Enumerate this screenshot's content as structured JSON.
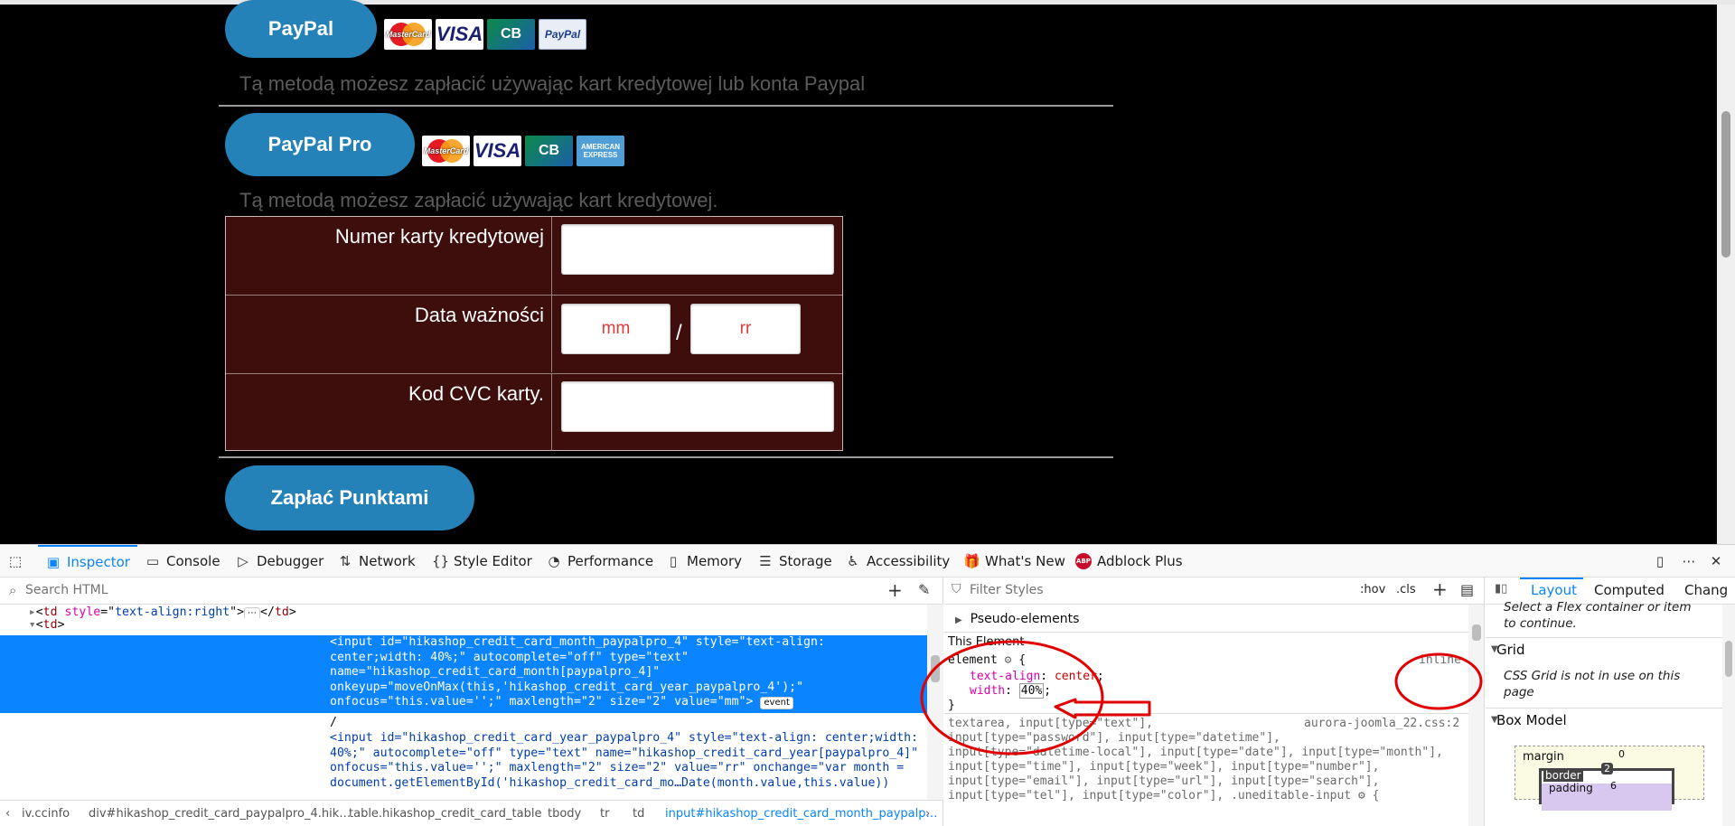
{
  "webpage": {
    "paypal_button": "PayPal",
    "paypal_desc": "Tą metodą możesz zapłacić używając kart kredytowej lub konta Paypal",
    "paypal_pro_button": "PayPal Pro",
    "paypal_pro_desc": "Tą metodą możesz zapłacić używając kart kredytowej.",
    "card_logos": {
      "mastercard": "MasterCard",
      "visa": "VISA",
      "cb": "CB",
      "paypal": "PayPal",
      "amex": "AMERICAN EXPRESS"
    },
    "form": {
      "card_number_label": "Numer karty kredytowej",
      "expiry_label": "Data ważności",
      "month_value": "mm",
      "year_value": "rr",
      "slash": "/",
      "cvc_label": "Kod CVC karty."
    },
    "points_button": "Zapłać Punktami"
  },
  "devtools": {
    "tabs": [
      {
        "label": "Inspector",
        "icon": "inspector-icon",
        "active": true
      },
      {
        "label": "Console",
        "icon": "console-icon"
      },
      {
        "label": "Debugger",
        "icon": "debugger-icon"
      },
      {
        "label": "Network",
        "icon": "network-icon"
      },
      {
        "label": "Style Editor",
        "icon": "style-editor-icon"
      },
      {
        "label": "Performance",
        "icon": "performance-icon"
      },
      {
        "label": "Memory",
        "icon": "memory-icon"
      },
      {
        "label": "Storage",
        "icon": "storage-icon"
      },
      {
        "label": "Accessibility",
        "icon": "accessibility-icon"
      },
      {
        "label": "What's New",
        "icon": "whats-new-icon"
      },
      {
        "label": "Adblock Plus",
        "icon": "adblock-plus-icon"
      }
    ],
    "abp_badge": "ABP",
    "markup": {
      "search_placeholder": "Search HTML",
      "line0_td": "td",
      "line0_style_attr": "style",
      "line0_style_val": "text-align:right",
      "line1_td": "td",
      "sel_line1": "<input id=\"hikashop_credit_card_month_paypalpro_4\" style=\"text-align:",
      "sel_line2": "center;width: 40%;\" autocomplete=\"off\" type=\"text\"",
      "sel_line3": "name=\"hikashop_credit_card_month[paypalpro_4]\"",
      "sel_line4": "onkeyup=\"moveOnMax(this,'hikashop_credit_card_year_paypalpro_4');\"",
      "sel_line5": "onfocus=\"this.value='';\" maxlength=\"2\" size=\"2\" value=\"mm\">",
      "event_badge": "event",
      "slash_line": "/",
      "y_line1": "<input id=\"hikashop_credit_card_year_paypalpro_4\" style=\"text-align: center;width:",
      "y_line2": "40%;\" autocomplete=\"off\" type=\"text\" name=\"hikashop_credit_card_year[paypalpro_4]\"",
      "y_line3": "onfocus=\"this.value='';\" maxlength=\"2\" size=\"2\" value=\"rr\" onchange=\"var month =",
      "y_line4": "document.getElementById('hikashop_credit_card_mo…Date(month.value,this.value))"
    },
    "breadcrumbs": [
      "iv.ccinfo",
      "div#hikashop_credit_card_paypalpro_4.hik…",
      "table.hikashop_credit_card_table",
      "tbody",
      "tr",
      "td",
      "input#hikashop_credit_card_month_paypalp…"
    ],
    "rules": {
      "filter_placeholder": "Filter Styles",
      "hov": ":hov",
      "cls": ".cls",
      "pseudo": "Pseudo-elements",
      "this_element": "This Element",
      "element_selector": "element",
      "open_brace": "{",
      "inline": "inline",
      "prop1": "text-align",
      "val1": "center",
      "prop2": "width",
      "val2": "40%",
      "close_brace": "}",
      "next_selector_start": "textarea, input[type=\"text\"],",
      "next_source": "aurora-joomla_22.css:2",
      "next_line2": "input[type=\"password\"], input[type=\"datetime\"],",
      "next_line3": "input[type=\"datetime-local\"], input[type=\"date\"], input[type=\"month\"],",
      "next_line4": "input[type=\"time\"], input[type=\"week\"], input[type=\"number\"],",
      "next_line5": "input[type=\"email\"], input[type=\"url\"], input[type=\"search\"],",
      "next_line6": "input[type=\"tel\"], input[type=\"color\"], .uneditable-input"
    },
    "layout": {
      "tabs": [
        "Layout",
        "Computed",
        "Chang"
      ],
      "flex_msg_1": "Select a Flex container or item",
      "flex_msg_2": "to continue.",
      "grid_title": "Grid",
      "grid_msg_1": "CSS Grid is not in use on this",
      "grid_msg_2": "page",
      "box_model_title": "Box Model",
      "margin_label": "margin",
      "margin_value": "0",
      "border_label": "border",
      "border_value": "2",
      "padding_label": "padding",
      "padding_value": "6"
    }
  },
  "colors": {
    "button_blue": "#2482b8",
    "table_bg": "#3d0e0c",
    "devtools_accent": "#0a84ff",
    "annotation_red": "#e00000"
  }
}
